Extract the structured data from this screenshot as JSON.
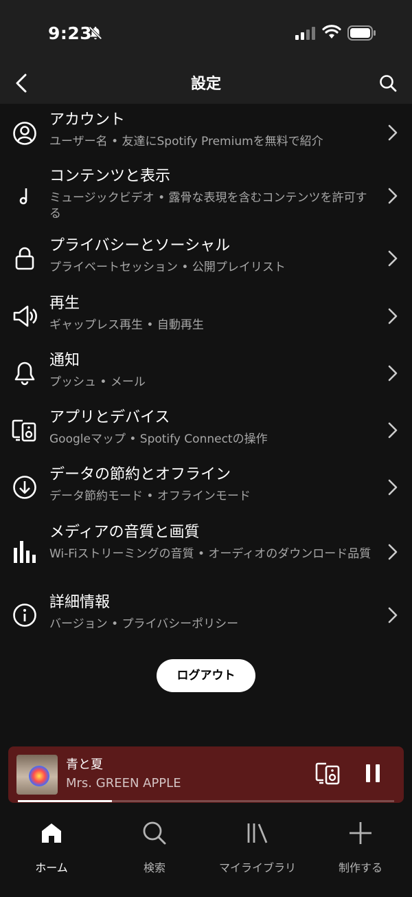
{
  "status_bar": {
    "time": "9:23",
    "icons": [
      "bell-off-icon",
      "signal-icon",
      "wifi-icon",
      "battery-icon"
    ]
  },
  "header": {
    "title": "設定",
    "back_icon": "back-chevron-icon",
    "search_icon": "search-icon"
  },
  "settings": {
    "items": [
      {
        "icon": "account-icon",
        "title": "アカウント",
        "subtitle": "ユーザー名 • 友達にSpotify Premiumを無料で紹介"
      },
      {
        "icon": "music-note-icon",
        "title": "コンテンツと表示",
        "subtitle": "ミュージックビデオ • 露骨な表現を含むコンテンツを許可する"
      },
      {
        "icon": "lock-icon",
        "title": "プライバシーとソーシャル",
        "subtitle": "プライベートセッション • 公開プレイリスト"
      },
      {
        "icon": "speaker-icon",
        "title": "再生",
        "subtitle": "ギャップレス再生 • 自動再生"
      },
      {
        "icon": "bell-icon",
        "title": "通知",
        "subtitle": "プッシュ • メール"
      },
      {
        "icon": "devices-icon",
        "title": "アプリとデバイス",
        "subtitle": "Googleマップ • Spotify Connectの操作"
      },
      {
        "icon": "download-icon",
        "title": "データの節約とオフライン",
        "subtitle": "データ節約モード • オフラインモード"
      },
      {
        "icon": "equalizer-icon",
        "title": "メディアの音質と画質",
        "subtitle": "Wi-Fiストリーミングの音質 • オーディオのダウンロード品質"
      },
      {
        "icon": "info-icon",
        "title": "詳細情報",
        "subtitle": "バージョン • プライバシーポリシー"
      }
    ]
  },
  "logout": {
    "label": "ログアウト"
  },
  "now_playing": {
    "title": "青と夏",
    "artist": "Mrs. GREEN APPLE",
    "progress_fraction": 0.25,
    "colors": {
      "background": "#5b1a1a"
    }
  },
  "bottom_nav": {
    "items": [
      {
        "icon": "home-icon",
        "label": "ホーム",
        "active": true
      },
      {
        "icon": "search-icon",
        "label": "検索",
        "active": false
      },
      {
        "icon": "library-icon",
        "label": "マイライブラリ",
        "active": false
      },
      {
        "icon": "plus-icon",
        "label": "制作する",
        "active": false
      }
    ]
  },
  "colors": {
    "background": "#121212",
    "header": "#1f1f1f",
    "subtitle": "#a7a7a7"
  }
}
